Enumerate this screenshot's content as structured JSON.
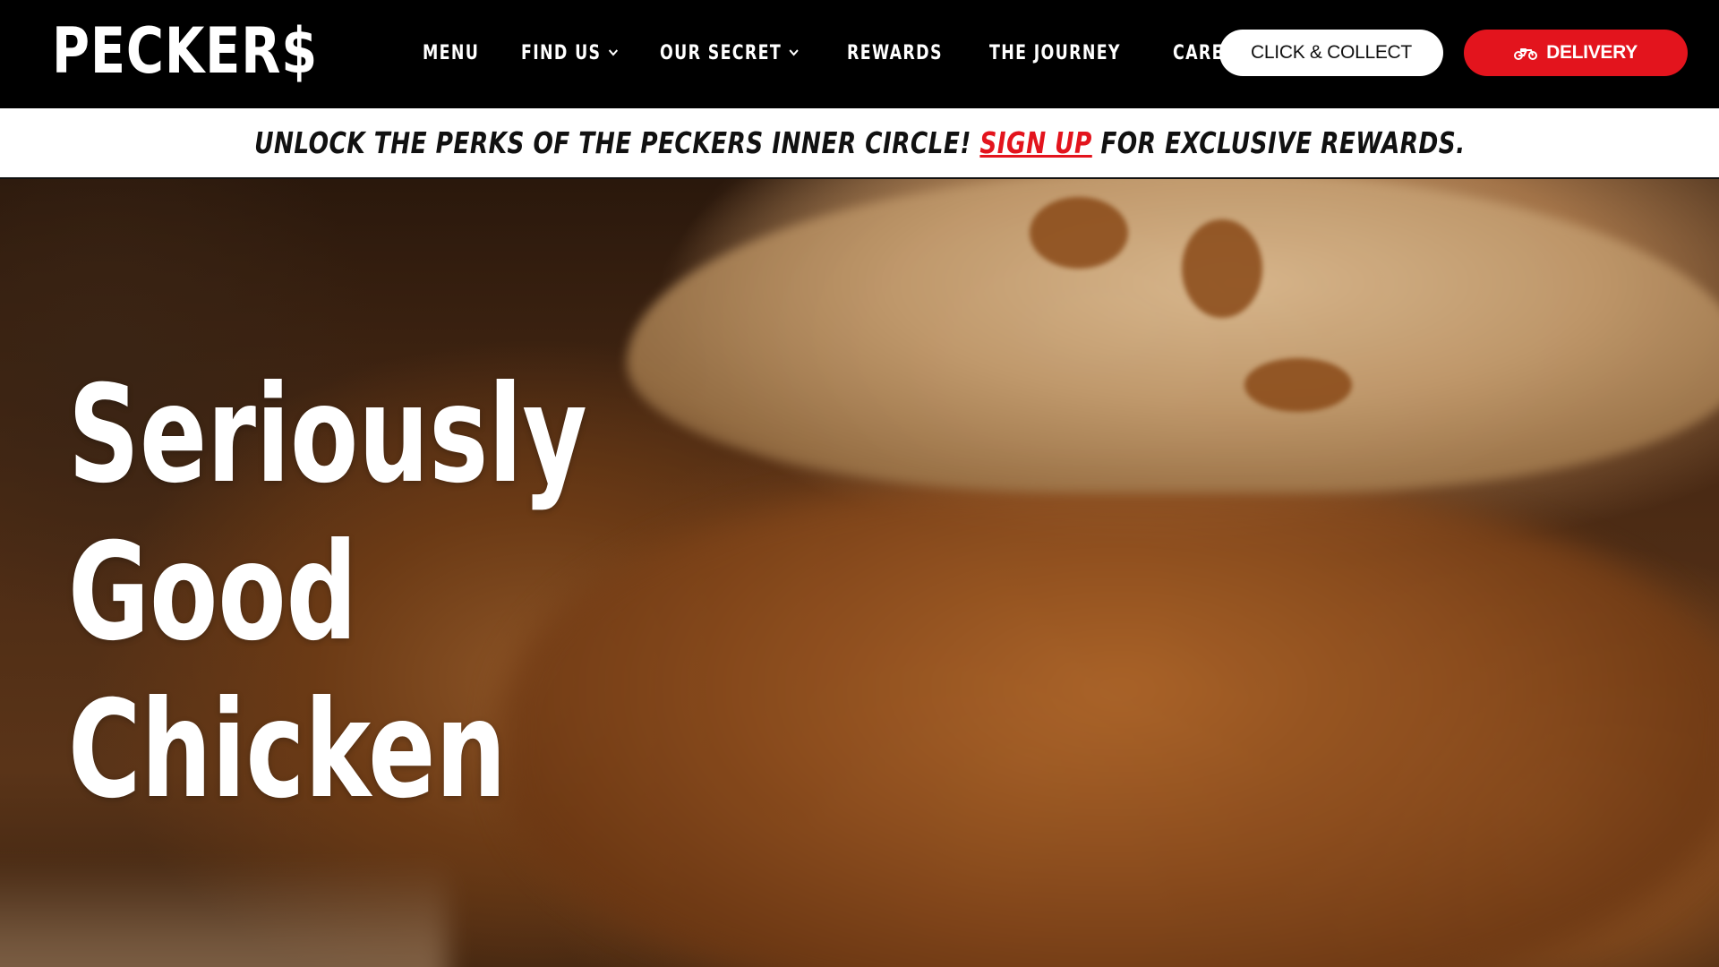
{
  "brand": {
    "logo_text": "PECKER$"
  },
  "nav": {
    "items": [
      {
        "label": "MENU",
        "has_dropdown": false
      },
      {
        "label": "FIND US",
        "has_dropdown": true
      },
      {
        "label": "OUR SECRET",
        "has_dropdown": true
      },
      {
        "label": "REWARDS",
        "has_dropdown": false
      },
      {
        "label": "THE JOURNEY",
        "has_dropdown": false
      },
      {
        "label": "CAREERS",
        "has_dropdown": false
      }
    ]
  },
  "actions": {
    "collect_label": "CLICK & COLLECT",
    "delivery_label": "DELIVERY",
    "delivery_icon": "scooter-icon",
    "accent_color": "#e3141d"
  },
  "banner": {
    "text_before": "UNLOCK THE PERKS OF THE PECKERS INNER CIRCLE!",
    "link_text": "SIGN UP",
    "text_after": "FOR EXCLUSIVE REWARDS."
  },
  "hero": {
    "title_lines": [
      "Seriously",
      "Good",
      "Chicken"
    ]
  }
}
